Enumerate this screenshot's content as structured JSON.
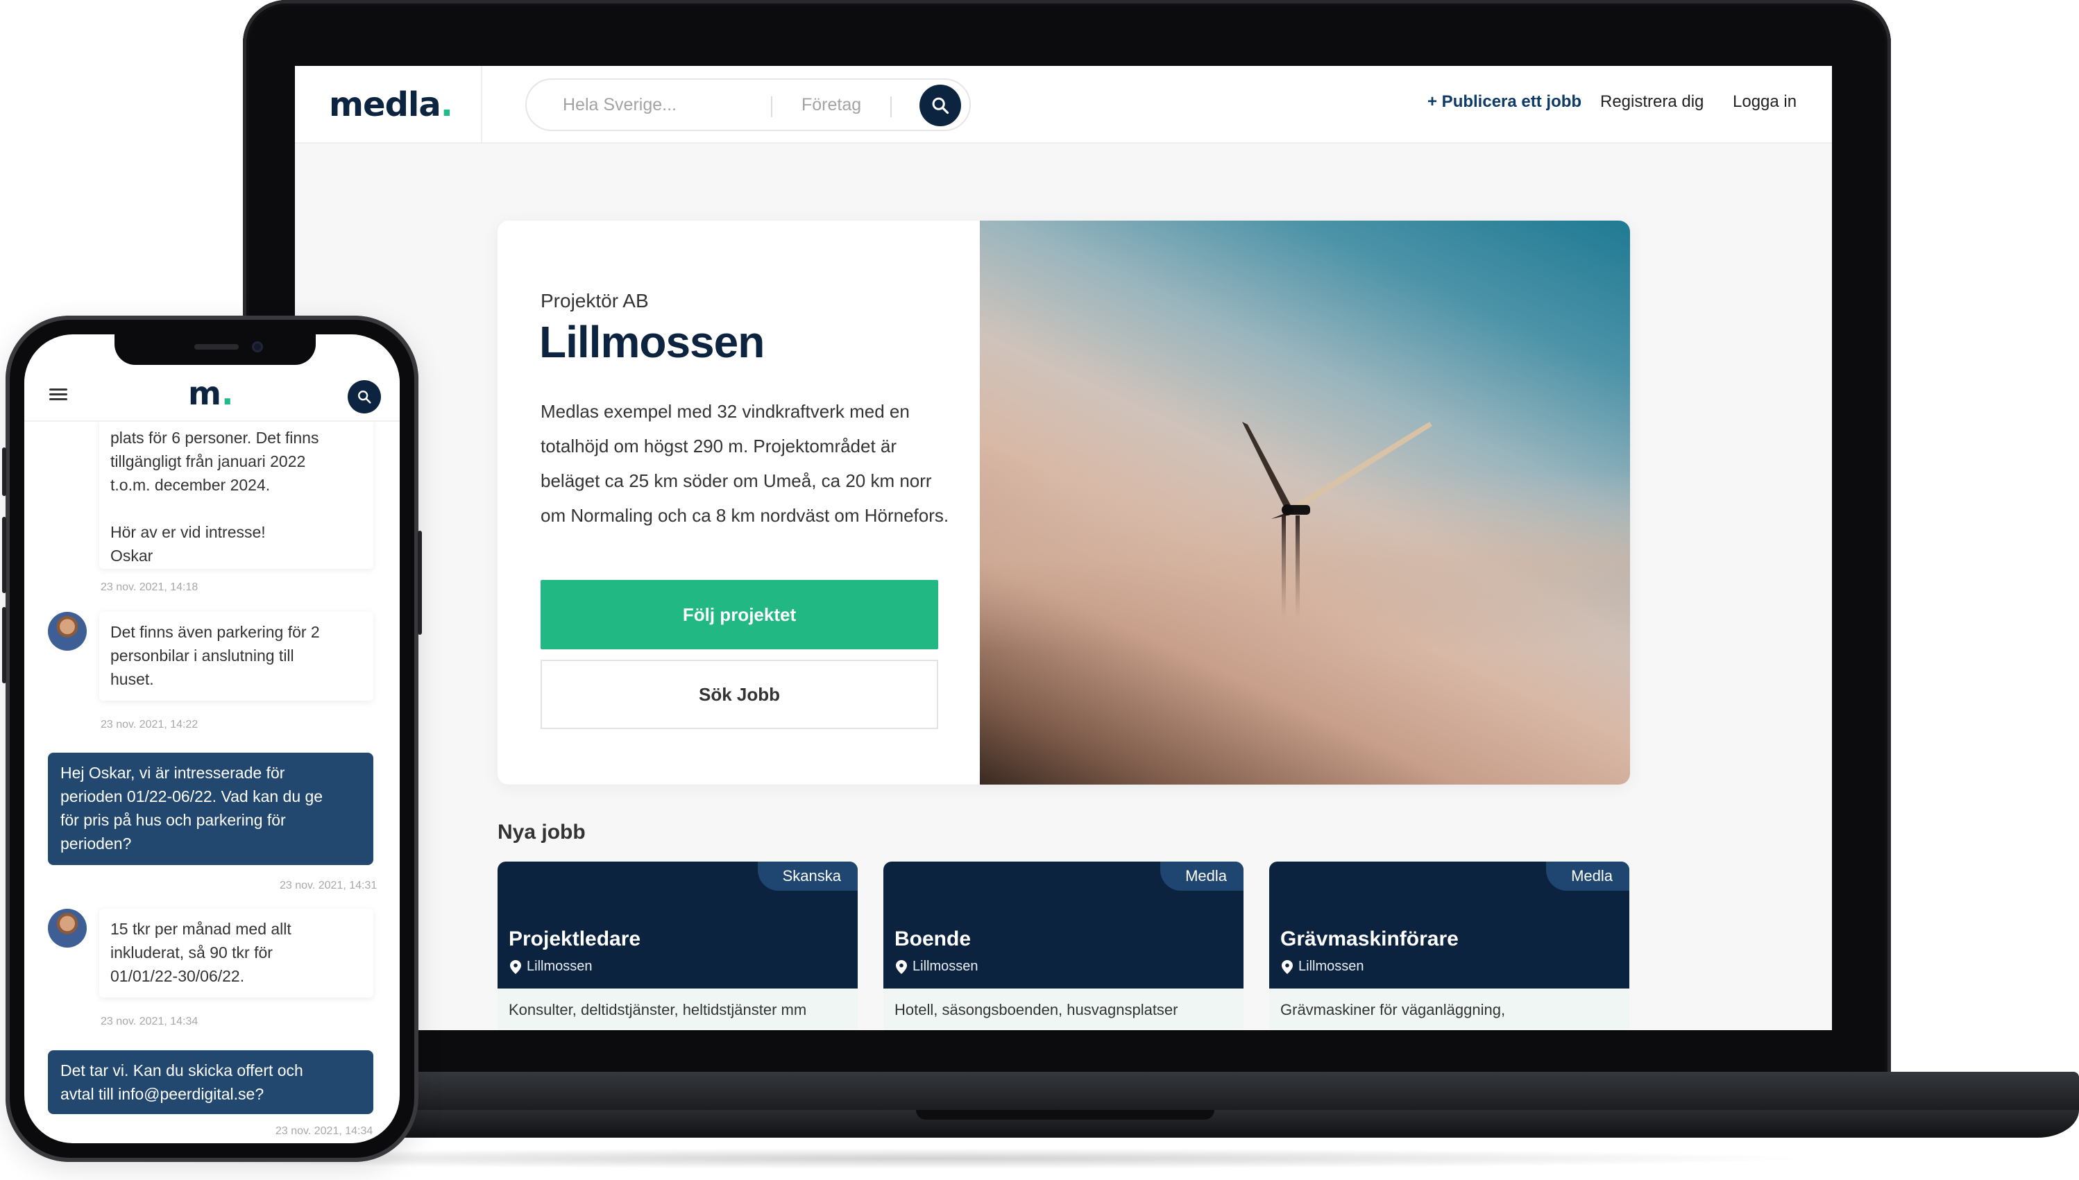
{
  "laptop": {
    "header": {
      "logo": "medla",
      "logo_dot": ".",
      "search_where_placeholder": "Hela Sverige...",
      "search_company_placeholder": "Företag",
      "nav": {
        "publish": "+ Publicera ett jobb",
        "register": "Registrera dig",
        "login": "Logga in"
      }
    },
    "hero": {
      "company": "Projektör AB",
      "title": "Lillmossen",
      "description": "Medlas exempel med 32 vindkraftverk med en totalhöjd om högst 290 m. Projektområdet är beläget ca 25 km söder om Umeå, ca 20 km norr om Normaling och ca 8 km nordväst om Hörnefors.",
      "follow_button": "Följ projektet",
      "jobs_button": "Sök Jobb"
    },
    "jobs": {
      "heading": "Nya jobb",
      "items": [
        {
          "badge": "Skanska",
          "title": "Projektledare",
          "location": "Lillmossen",
          "description": "Konsulter, deltidstjänster, heltidstjänster mm"
        },
        {
          "badge": "Medla",
          "title": "Boende",
          "location": "Lillmossen",
          "description": "Hotell, säsongsboenden, husvagnsplatser"
        },
        {
          "badge": "Medla",
          "title": "Grävmaskinförare",
          "location": "Lillmossen",
          "description": "Grävmaskiner för väganläggning,"
        }
      ]
    }
  },
  "phone": {
    "header": {
      "logo": "m",
      "logo_dot": "."
    },
    "messages": [
      {
        "type": "in",
        "text_lines": [
          "plats för 6 personer. Det finns",
          "tillgängligt från januari 2022",
          "t.o.m. december 2024.",
          "",
          "Hör av er vid intresse!",
          "Oskar"
        ],
        "time": "23 nov. 2021, 14:18"
      },
      {
        "type": "in",
        "text_lines": [
          "Det finns även parkering för 2",
          "personbilar i anslutning till",
          "huset."
        ],
        "time": "23 nov. 2021, 14:22"
      },
      {
        "type": "out",
        "text_lines": [
          "Hej Oskar, vi är intresserade för",
          "perioden 01/22-06/22. Vad kan du ge",
          "för pris på hus och parkering för",
          "perioden?"
        ],
        "time": "23 nov. 2021, 14:31"
      },
      {
        "type": "in",
        "text_lines": [
          "15 tkr per månad med allt",
          "inkluderat, så 90 tkr för",
          "01/01/22-30/06/22."
        ],
        "time": "23 nov. 2021, 14:34"
      },
      {
        "type": "out",
        "text_lines": [
          "Det tar vi. Kan du skicka offert och",
          "avtal till info@peerdigital.se?"
        ],
        "time": "23 nov. 2021, 14:34"
      }
    ]
  },
  "colors": {
    "brand_navy": "#0d2440",
    "brand_green": "#21b884",
    "bubble_out": "#22486f",
    "job_card": "#0c2340",
    "badge": "#1e4670"
  },
  "icons": [
    "search-icon",
    "hamburger-icon",
    "location-pin-icon",
    "user-avatar"
  ]
}
